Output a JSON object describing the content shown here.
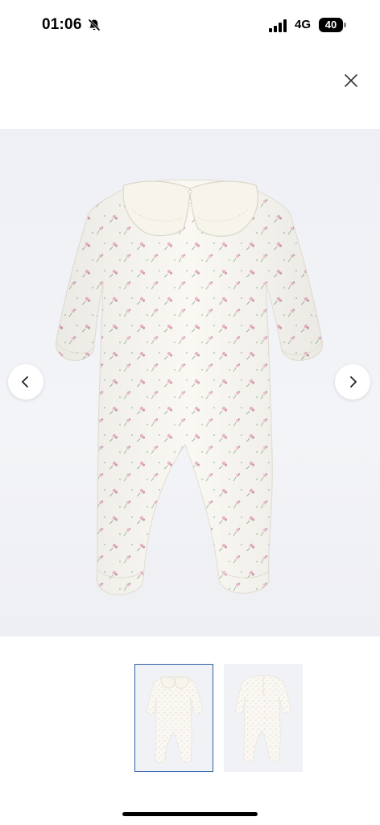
{
  "status_bar": {
    "time": "01:06",
    "network": "4G",
    "battery": "40",
    "icons": [
      "bell-muted-icon",
      "signal-icon",
      "battery-icon"
    ]
  },
  "header": {
    "close_icon": "close-icon"
  },
  "gallery": {
    "image_description_icon": "product-romper-image",
    "prev_icon": "chevron-left-icon",
    "next_icon": "chevron-right-icon",
    "background": "#f1f2f5"
  },
  "thumbnails": {
    "items": [
      {
        "selected": true
      },
      {
        "selected": false
      }
    ],
    "selected_border": "#2f5fa8"
  }
}
